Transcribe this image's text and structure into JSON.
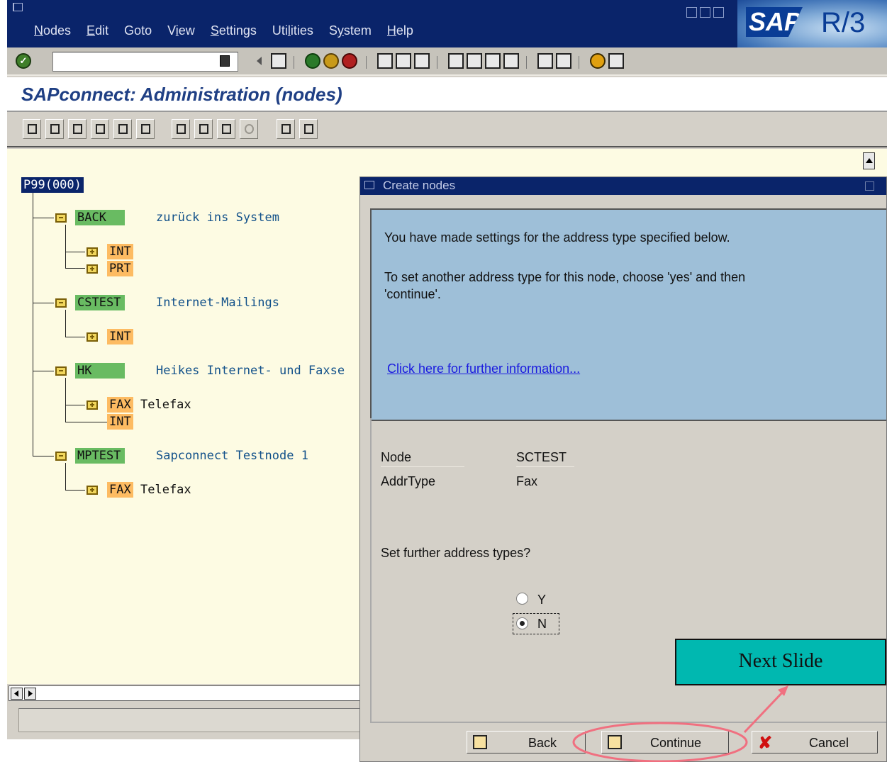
{
  "menu": {
    "items": [
      {
        "u": "N",
        "rest": "odes"
      },
      {
        "u": "E",
        "rest": "dit"
      },
      {
        "u": "",
        "rest": "Goto"
      },
      {
        "pre": "V",
        "u": "i",
        "rest": "ew"
      },
      {
        "u": "S",
        "rest": "ettings"
      },
      {
        "pre": "Uti",
        "u": "l",
        "rest": "ities"
      },
      {
        "pre": "S",
        "u": "y",
        "rest": "stem"
      },
      {
        "u": "H",
        "rest": "elp"
      }
    ]
  },
  "logo": {
    "sap": "SAP",
    "r3": "R/3"
  },
  "command_field": {
    "value": ""
  },
  "page": {
    "title": "SAPconnect: Administration (nodes)"
  },
  "tree": {
    "root": "P99(000)",
    "back": {
      "name": "BACK",
      "desc": "zurück ins System",
      "children": [
        "INT",
        "PRT"
      ]
    },
    "cstest": {
      "name": "CSTEST",
      "desc": "Internet-Mailings",
      "children": [
        "INT"
      ]
    },
    "hk": {
      "name": "HK",
      "desc": "Heikes Internet- und Faxse",
      "fax": "FAX",
      "fax_desc": "Telefax",
      "int": "INT"
    },
    "mptest": {
      "name": "MPTEST",
      "desc": "Sapconnect Testnode 1",
      "fax": "FAX",
      "fax_desc": "Telefax"
    }
  },
  "dialog": {
    "title": "Create nodes",
    "info_line1": "You have made settings for the address type specified below.",
    "info_line2": "To set another address type for this node, choose 'yes' and then",
    "info_line3": "'continue'.",
    "info_link": "Click here for further information...",
    "node_label": "Node",
    "node_value": "SCTEST",
    "addrtype_label": "AddrType",
    "addrtype_value": "Fax",
    "question": "Set further address types?",
    "option_y": "Y",
    "option_n": "N",
    "selected": "N",
    "buttons": {
      "back": "Back",
      "continue": "Continue",
      "cancel": "Cancel"
    }
  },
  "annotation": {
    "next_slide": "Next Slide"
  },
  "colors": {
    "title_bar": "#0a246a",
    "tree_bg": "#fdfbe3",
    "node_green": "#69bb62",
    "node_orange": "#fdbb62",
    "info_panel": "#9ebfd8",
    "callout": "#00b8b0",
    "highlight_ellipse": "#f07080"
  }
}
